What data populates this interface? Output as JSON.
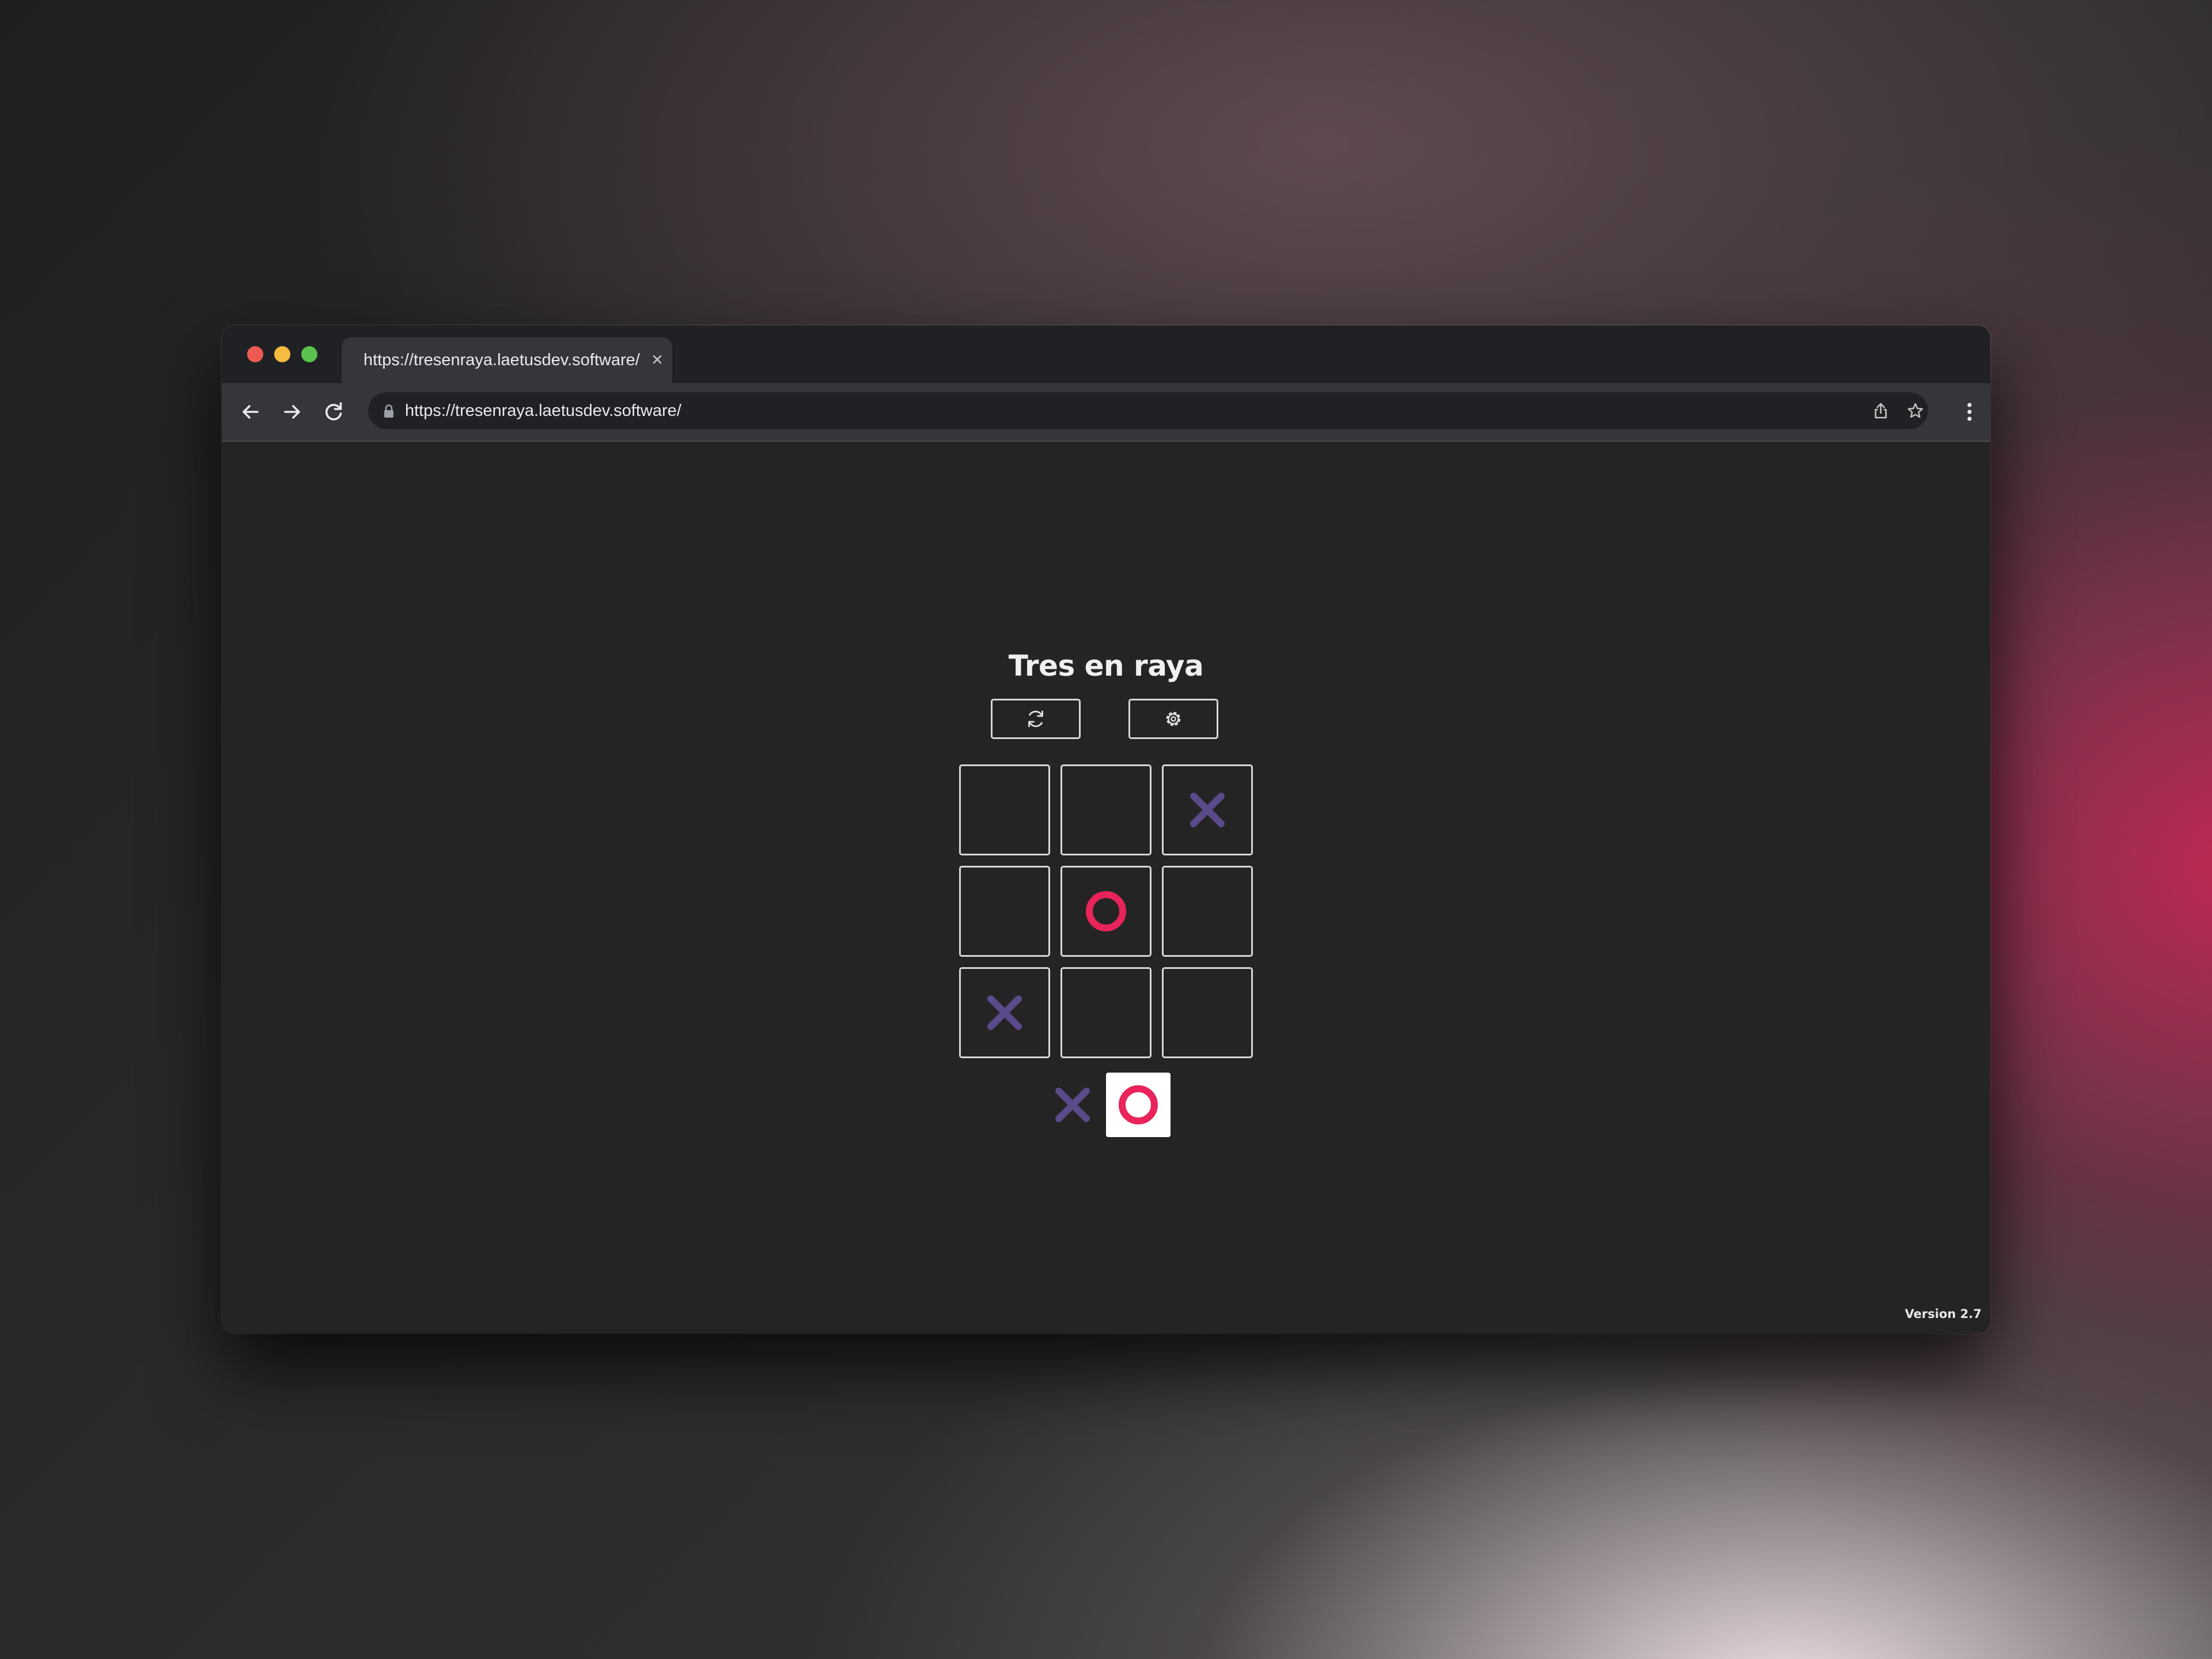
{
  "browser": {
    "tab": {
      "title": "https://tresenraya.laetusdev.software/",
      "close_icon": "close-icon"
    },
    "toolbar": {
      "back_icon": "arrow-left-icon",
      "forward_icon": "arrow-right-icon",
      "reload_icon": "reload-icon",
      "lock_icon": "lock-icon",
      "url": "https://tresenraya.laetusdev.software/",
      "share_icon": "share-icon",
      "bookmark_icon": "star-icon",
      "menu_icon": "kebab-menu-icon"
    }
  },
  "page": {
    "title": "Tres en raya",
    "controls": {
      "restart_icon": "restart-icon",
      "settings_icon": "gear-icon"
    },
    "board": [
      [
        "",
        "",
        "X"
      ],
      [
        "",
        "O",
        ""
      ],
      [
        "X",
        "",
        ""
      ]
    ],
    "turn_indicator": {
      "players": [
        "X",
        "O"
      ],
      "active": "O"
    },
    "version": "Version 2.7"
  },
  "colors": {
    "x_mark": "#5a4a8a",
    "o_mark": "#e8245a",
    "cell_border": "#d8d8d8",
    "page_background": "#242424",
    "active_player_background": "#ffffff"
  }
}
